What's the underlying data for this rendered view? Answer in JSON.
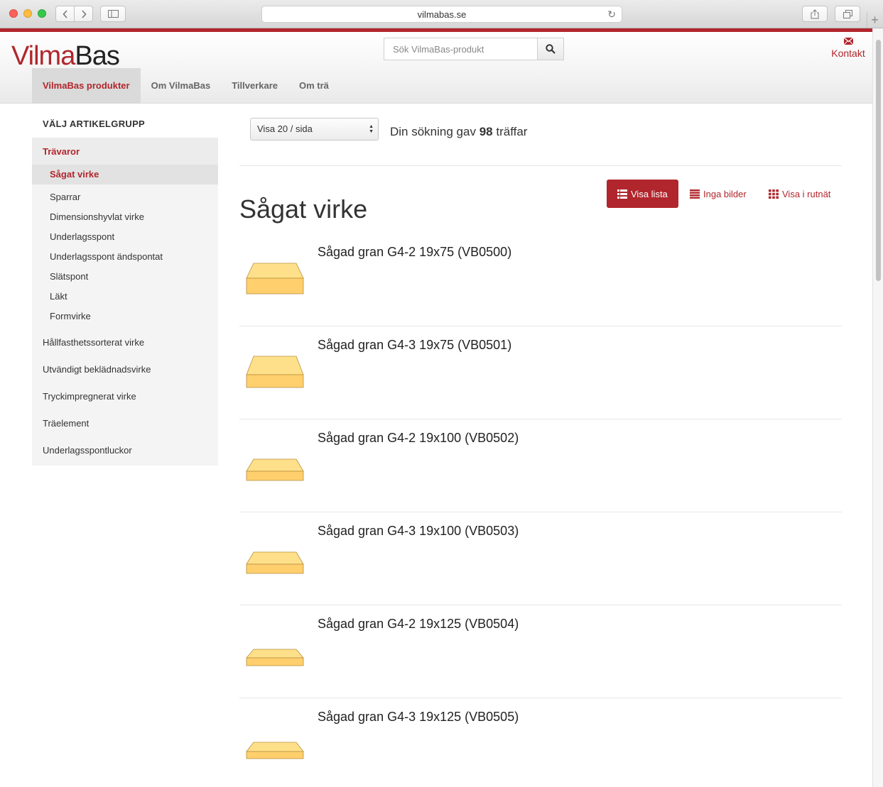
{
  "browser": {
    "url": "vilmabas.se"
  },
  "header": {
    "logo_part1": "Vilma",
    "logo_part2": "Bas",
    "search_placeholder": "Sök VilmaBas-produkt",
    "contact_label": "Kontakt"
  },
  "nav": {
    "items": [
      {
        "label": "VilmaBas produkter",
        "active": true
      },
      {
        "label": "Om VilmaBas"
      },
      {
        "label": "Tillverkare"
      },
      {
        "label": "Om trä"
      }
    ]
  },
  "sidebar": {
    "title": "VÄLJ ARTIKELGRUPP",
    "category": "Trävaror",
    "subitems": [
      {
        "label": "Sågat virke",
        "active": true
      },
      {
        "label": "Sparrar"
      },
      {
        "label": "Dimensionshyvlat virke"
      },
      {
        "label": "Underlagsspont"
      },
      {
        "label": "Underlagsspont ändspontat"
      },
      {
        "label": "Slätspont"
      },
      {
        "label": "Läkt"
      },
      {
        "label": "Formvirke"
      }
    ],
    "top_items": [
      {
        "label": "Hållfasthetssorterat virke"
      },
      {
        "label": "Utvändigt beklädnadsvirke"
      },
      {
        "label": "Tryckimpregnerat virke"
      },
      {
        "label": "Träelement"
      },
      {
        "label": "Underlagsspontluckor"
      }
    ]
  },
  "toolbar": {
    "per_page": "Visa 20 / sida",
    "hits_prefix": "Din sökning gav",
    "hits_count": "98",
    "hits_suffix": "träffar"
  },
  "main": {
    "heading": "Sågat virke",
    "view_list": "Visa lista",
    "view_no_images": "Inga bilder",
    "view_grid": "Visa i rutnät"
  },
  "colors": {
    "accent": "#b0262c",
    "wood_top": "#ffe08a",
    "wood_side": "#ffcf6e"
  },
  "products": [
    {
      "name": "Sågad gran G4-2 19x75 (VB0500)"
    },
    {
      "name": "Sågad gran G4-3 19x75 (VB0501)"
    },
    {
      "name": "Sågad gran G4-2 19x100 (VB0502)"
    },
    {
      "name": "Sågad gran G4-3 19x100 (VB0503)"
    },
    {
      "name": "Sågad gran G4-2 19x125 (VB0504)"
    },
    {
      "name": "Sågad gran G4-3 19x125 (VB0505)"
    }
  ]
}
